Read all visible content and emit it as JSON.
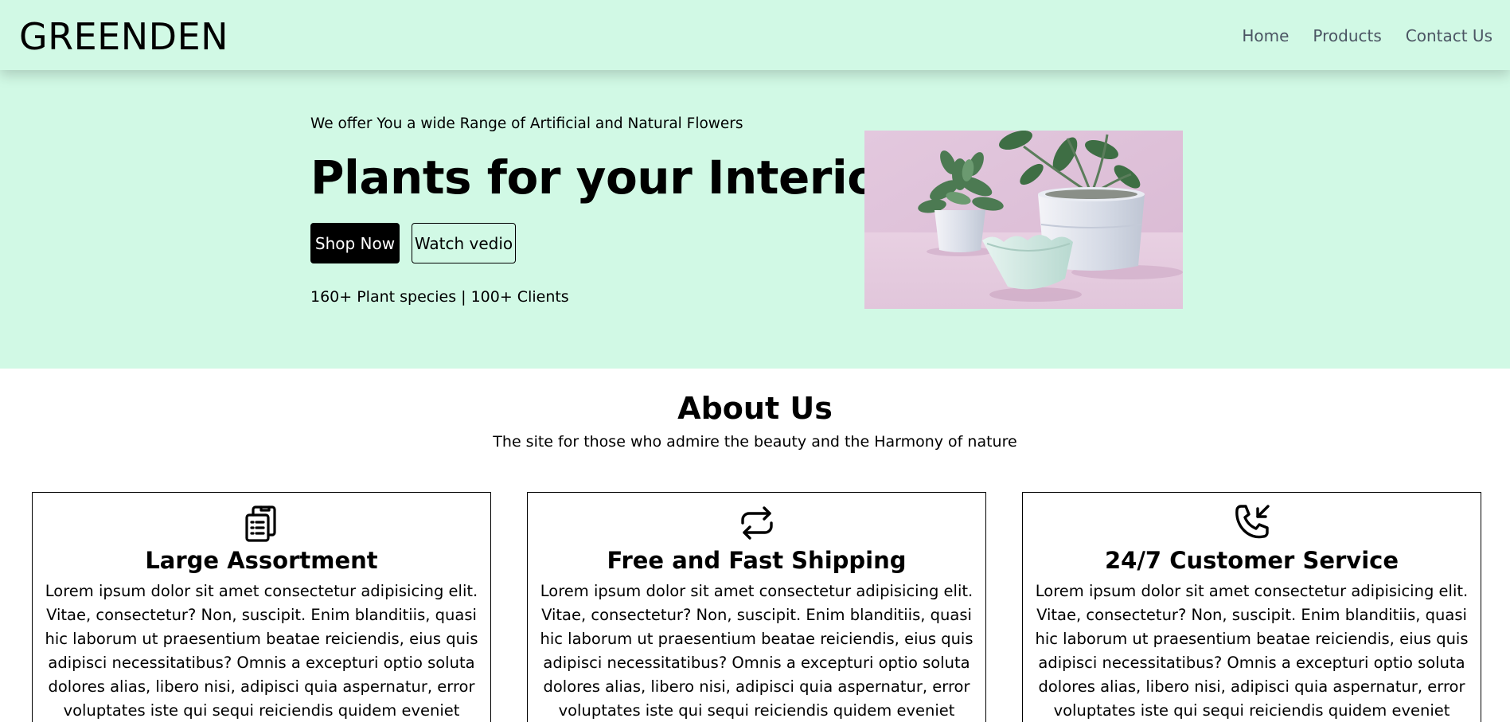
{
  "navbar": {
    "brand": "GREENDEN",
    "links": [
      "Home",
      "Products",
      "Contact Us"
    ]
  },
  "hero": {
    "subtitle": "We offer You a wide Range of Artificial and Natural Flowers",
    "title": "Plants for your Interior",
    "primary_button": "Shop Now",
    "secondary_button": "Watch vedio",
    "stats": "160+ Plant species | 100+ Clients",
    "image_icon": "potted-plants-photo"
  },
  "about": {
    "title": "About Us",
    "subtitle": "The site for those who admire the beauty and the Harmony of nature"
  },
  "features": [
    {
      "icon": "clipboard-list-icon",
      "title": "Large Assortment",
      "text": "Lorem ipsum dolor sit amet consectetur adipisicing elit. Vitae, consectetur? Non, suscipit. Enim blanditiis, quasi hic laborum ut praesentium beatae reiciendis, eius quis adipisci necessitatibus? Omnis a excepturi optio soluta dolores alias, libero nisi, adipisci quia aspernatur, error voluptates iste qui sequi reiciendis quidem eveniet nulla repudiandae natus."
    },
    {
      "icon": "refresh-arrows-icon",
      "title": "Free and Fast Shipping",
      "text": "Lorem ipsum dolor sit amet consectetur adipisicing elit. Vitae, consectetur? Non, suscipit. Enim blanditiis, quasi hic laborum ut praesentium beatae reiciendis, eius quis adipisci necessitatibus? Omnis a excepturi optio soluta dolores alias, libero nisi, adipisci quia aspernatur, error voluptates iste qui sequi reiciendis quidem eveniet nulla repudiandae natus."
    },
    {
      "icon": "phone-incoming-icon",
      "title": "24/7 Customer Service",
      "text": "Lorem ipsum dolor sit amet consectetur adipisicing elit. Vitae, consectetur? Non, suscipit. Enim blanditiis, quasi hic laborum ut praesentium beatae reiciendis, eius quis adipisci necessitatibus? Omnis a excepturi optio soluta dolores alias, libero nisi, adipisci quia aspernatur, error voluptates iste qui sequi reiciendis quidem eveniet nulla repudiandae natus."
    }
  ],
  "colors": {
    "hero_background": "#d1f9e5",
    "nav_link": "#4b5563",
    "primary_button": "#000000"
  }
}
